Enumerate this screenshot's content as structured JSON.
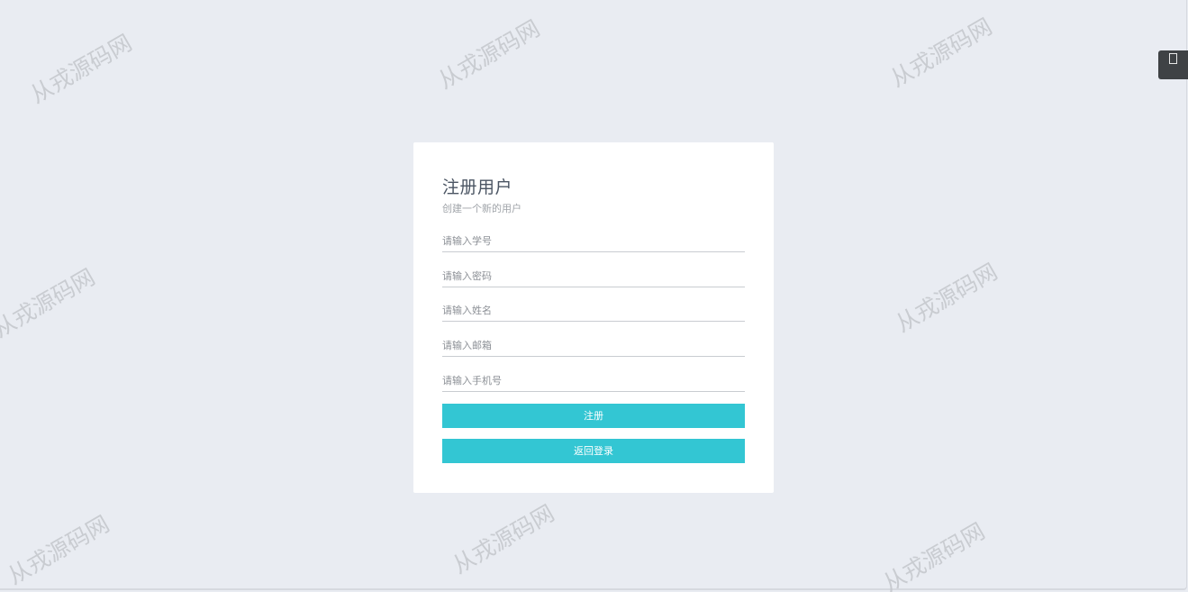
{
  "watermark": {
    "text": "从戎源码网"
  },
  "corner_button": {
    "icon": "square-icon"
  },
  "register": {
    "title": "注册用户",
    "subtitle": "创建一个新的用户",
    "fields": {
      "student_id": {
        "placeholder": "请输入学号",
        "value": ""
      },
      "password": {
        "placeholder": "请输入密码",
        "value": ""
      },
      "name": {
        "placeholder": "请输入姓名",
        "value": ""
      },
      "email": {
        "placeholder": "请输入邮箱",
        "value": ""
      },
      "phone": {
        "placeholder": "请输入手机号",
        "value": ""
      }
    },
    "register_label": "注册",
    "back_label": "返回登录"
  },
  "colors": {
    "background": "#e9ecf2",
    "card": "#ffffff",
    "accent": "#33c6d3",
    "corner_button": "#3f4245"
  }
}
